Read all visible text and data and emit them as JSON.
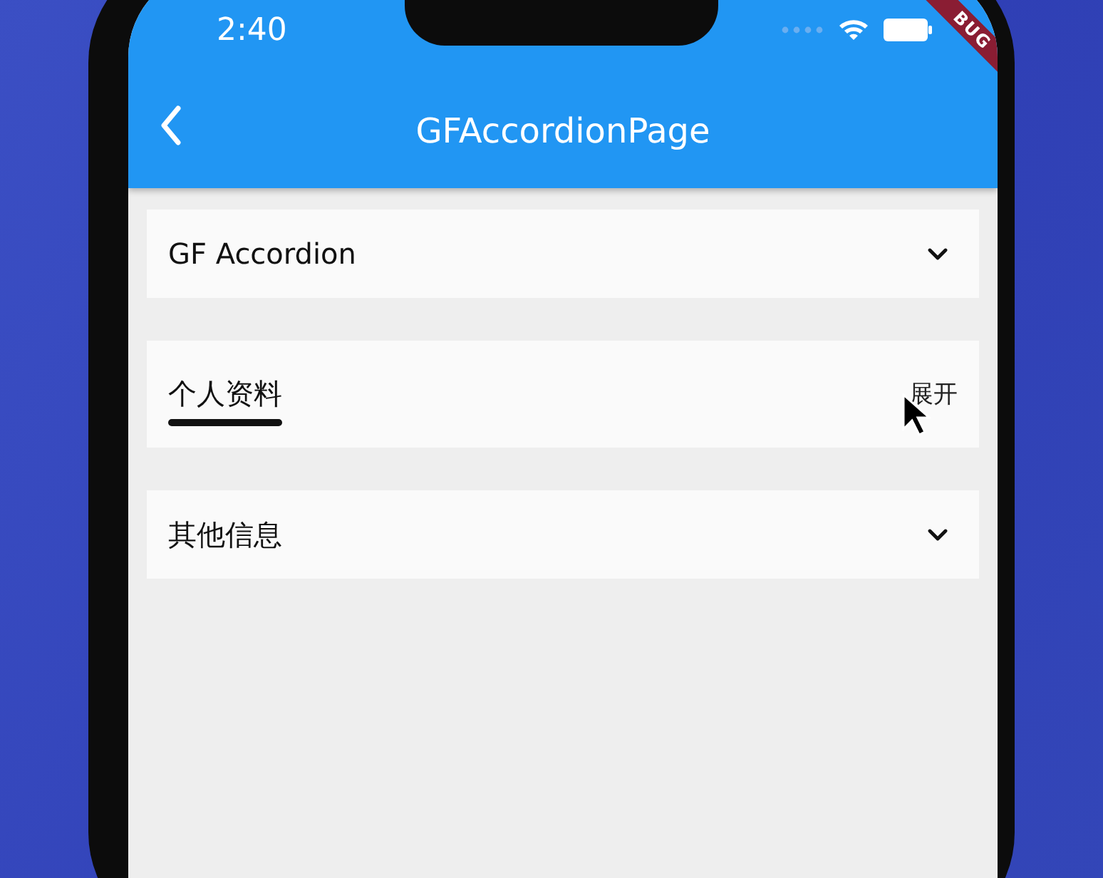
{
  "status_bar": {
    "time": "2:40"
  },
  "debug_banner": {
    "label": "BUG"
  },
  "app_bar": {
    "title": "GFAccordionPage"
  },
  "accordions": [
    {
      "title": "GF Accordion",
      "kind": "chevron"
    },
    {
      "title": "个人资料",
      "kind": "text_toggle",
      "toggle_label": "展开"
    },
    {
      "title": "其他信息",
      "kind": "chevron"
    }
  ]
}
